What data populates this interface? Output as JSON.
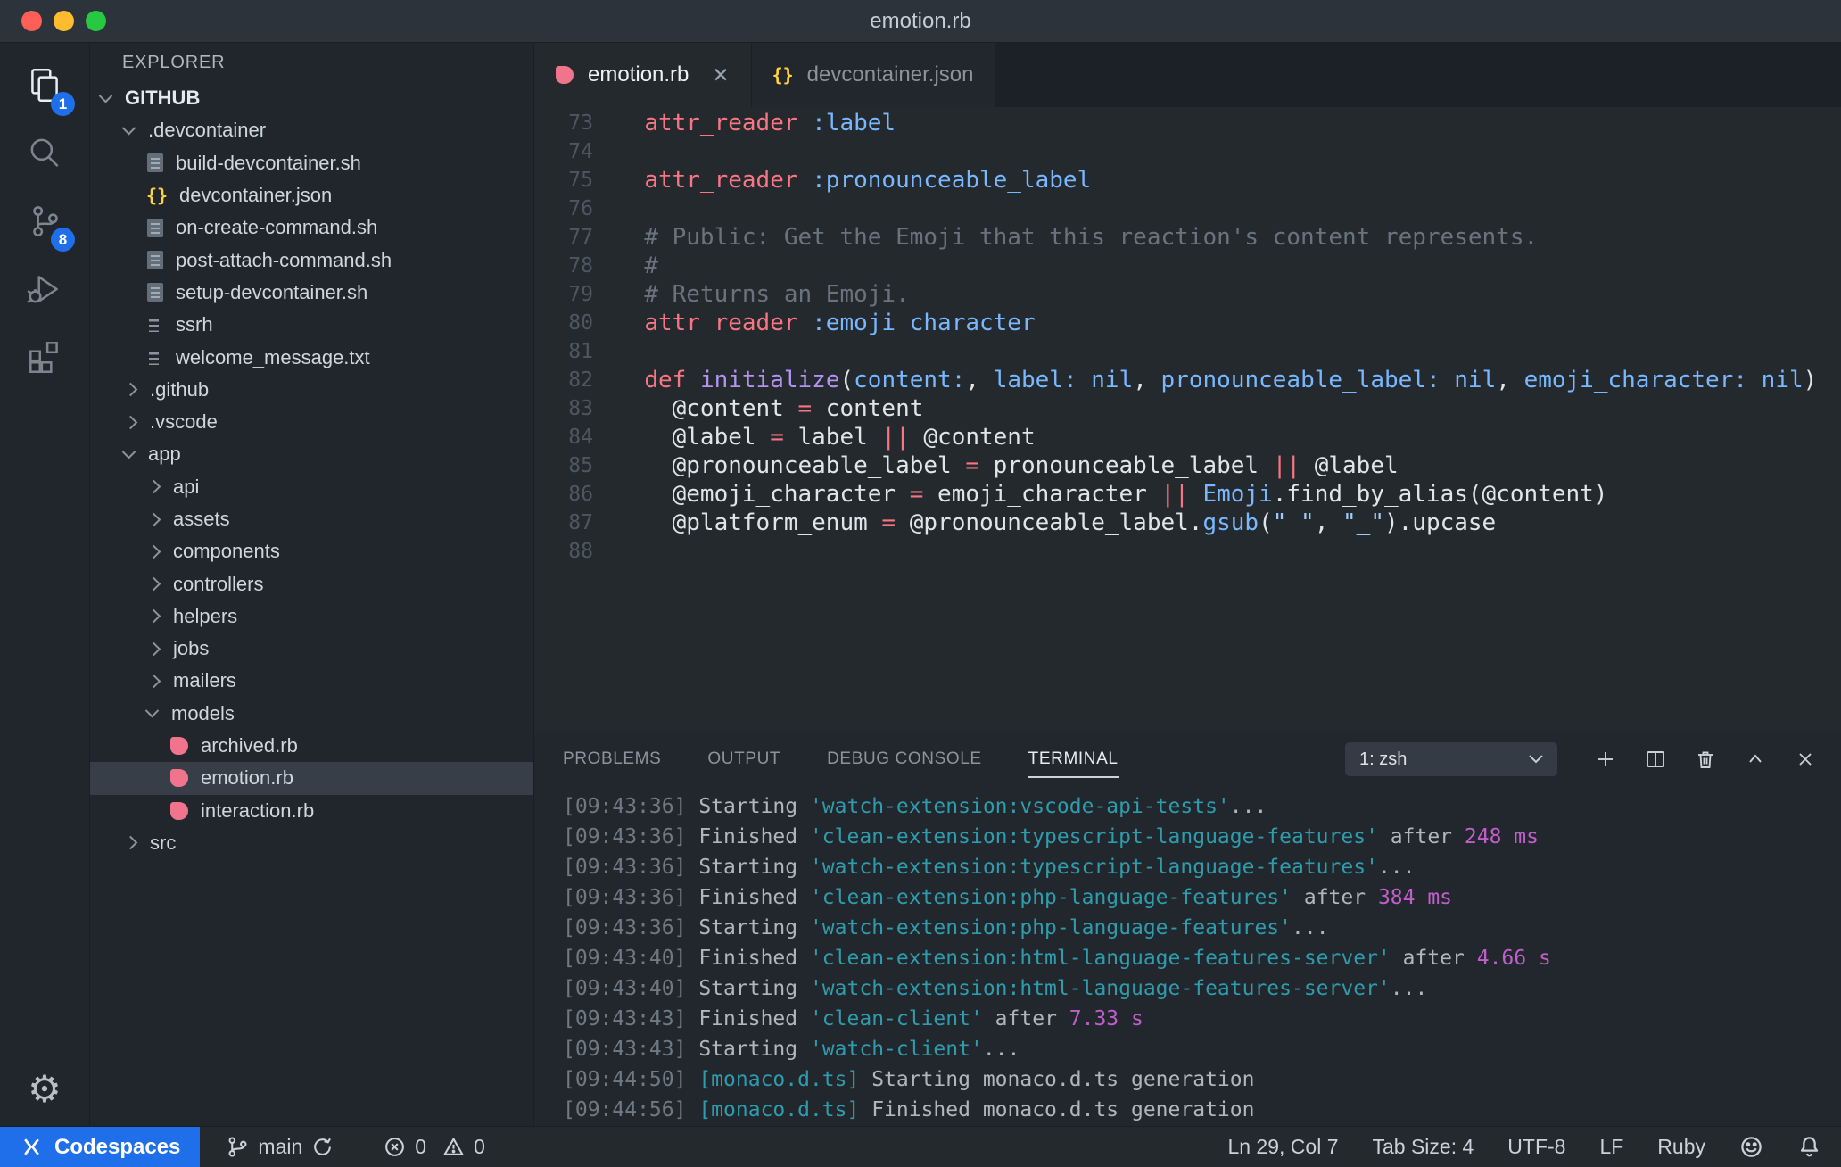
{
  "window": {
    "title": "emotion.rb"
  },
  "colors": {
    "accent_blue": "#1f6feb",
    "ruby_pink": "#f0758c",
    "json_yellow": "#ffd33d",
    "traffic_red": "#ff5f57",
    "traffic_yellow": "#febc2e",
    "traffic_green": "#28c840",
    "syntax_keyword": "#f97583",
    "syntax_symbol": "#79b8ff",
    "syntax_function": "#b392f0",
    "syntax_comment": "#6a737d",
    "syntax_string": "#9ecbff",
    "terminal_task": "#2e9cac",
    "terminal_duration": "#c05fc9"
  },
  "activity_bar": {
    "explorer_badge": "1",
    "source_control_badge": "8"
  },
  "sidebar": {
    "header": "EXPLORER",
    "items": [
      {
        "label": "GITHUB",
        "level": 0,
        "kind": "folder",
        "expanded": true,
        "bold": true
      },
      {
        "label": ".devcontainer",
        "level": 1,
        "kind": "folder",
        "expanded": true
      },
      {
        "label": "build-devcontainer.sh",
        "level": 2,
        "kind": "file",
        "icon": "shell"
      },
      {
        "label": "devcontainer.json",
        "level": 2,
        "kind": "file",
        "icon": "json"
      },
      {
        "label": "on-create-command.sh",
        "level": 2,
        "kind": "file",
        "icon": "shell"
      },
      {
        "label": "post-attach-command.sh",
        "level": 2,
        "kind": "file",
        "icon": "shell"
      },
      {
        "label": "setup-devcontainer.sh",
        "level": 2,
        "kind": "file",
        "icon": "shell"
      },
      {
        "label": "ssrh",
        "level": 2,
        "kind": "file",
        "icon": "text"
      },
      {
        "label": "welcome_message.txt",
        "level": 2,
        "kind": "file",
        "icon": "text"
      },
      {
        "label": ".github",
        "level": 1,
        "kind": "folder",
        "expanded": false
      },
      {
        "label": ".vscode",
        "level": 1,
        "kind": "folder",
        "expanded": false
      },
      {
        "label": "app",
        "level": 1,
        "kind": "folder",
        "expanded": true
      },
      {
        "label": "api",
        "level": 2,
        "kind": "folder",
        "expanded": false
      },
      {
        "label": "assets",
        "level": 2,
        "kind": "folder",
        "expanded": false
      },
      {
        "label": "components",
        "level": 2,
        "kind": "folder",
        "expanded": false
      },
      {
        "label": "controllers",
        "level": 2,
        "kind": "folder",
        "expanded": false
      },
      {
        "label": "helpers",
        "level": 2,
        "kind": "folder",
        "expanded": false
      },
      {
        "label": "jobs",
        "level": 2,
        "kind": "folder",
        "expanded": false
      },
      {
        "label": "mailers",
        "level": 2,
        "kind": "folder",
        "expanded": false
      },
      {
        "label": "models",
        "level": 2,
        "kind": "folder",
        "expanded": true
      },
      {
        "label": "archived.rb",
        "level": 3,
        "kind": "file",
        "icon": "ruby"
      },
      {
        "label": "emotion.rb",
        "level": 3,
        "kind": "file",
        "icon": "ruby",
        "selected": true
      },
      {
        "label": "interaction.rb",
        "level": 3,
        "kind": "file",
        "icon": "ruby"
      },
      {
        "label": "src",
        "level": 1,
        "kind": "folder",
        "expanded": false
      }
    ]
  },
  "editor_tabs": [
    {
      "label": "emotion.rb",
      "icon": "ruby",
      "active": true,
      "close_glyph": "✕"
    },
    {
      "label": "devcontainer.json",
      "icon": "json",
      "active": false
    }
  ],
  "editor": {
    "lines": [
      {
        "num": "73",
        "segments": [
          {
            "c": "pl",
            "t": "  "
          },
          {
            "c": "kw",
            "t": "attr_reader"
          },
          {
            "c": "pl",
            "t": " "
          },
          {
            "c": "sym",
            "t": ":label"
          }
        ]
      },
      {
        "num": "74",
        "segments": []
      },
      {
        "num": "75",
        "segments": [
          {
            "c": "pl",
            "t": "  "
          },
          {
            "c": "kw",
            "t": "attr_reader"
          },
          {
            "c": "pl",
            "t": " "
          },
          {
            "c": "sym",
            "t": ":pronounceable_label"
          }
        ]
      },
      {
        "num": "76",
        "segments": []
      },
      {
        "num": "77",
        "segments": [
          {
            "c": "pl",
            "t": "  "
          },
          {
            "c": "cm",
            "t": "# Public: Get the Emoji that this reaction's content represents."
          }
        ]
      },
      {
        "num": "78",
        "segments": [
          {
            "c": "pl",
            "t": "  "
          },
          {
            "c": "cm",
            "t": "#"
          }
        ]
      },
      {
        "num": "79",
        "segments": [
          {
            "c": "pl",
            "t": "  "
          },
          {
            "c": "cm",
            "t": "# Returns an Emoji."
          }
        ]
      },
      {
        "num": "80",
        "segments": [
          {
            "c": "pl",
            "t": "  "
          },
          {
            "c": "kw",
            "t": "attr_reader"
          },
          {
            "c": "pl",
            "t": " "
          },
          {
            "c": "sym",
            "t": ":emoji_character"
          }
        ]
      },
      {
        "num": "81",
        "segments": []
      },
      {
        "num": "82",
        "segments": [
          {
            "c": "pl",
            "t": "  "
          },
          {
            "c": "kw",
            "t": "def"
          },
          {
            "c": "pl",
            "t": " "
          },
          {
            "c": "fn",
            "t": "initialize"
          },
          {
            "c": "pl",
            "t": "("
          },
          {
            "c": "sym",
            "t": "content:"
          },
          {
            "c": "pl",
            "t": ", "
          },
          {
            "c": "sym",
            "t": "label:"
          },
          {
            "c": "pl",
            "t": " "
          },
          {
            "c": "sym",
            "t": "nil"
          },
          {
            "c": "pl",
            "t": ", "
          },
          {
            "c": "sym",
            "t": "pronounceable_label:"
          },
          {
            "c": "pl",
            "t": " "
          },
          {
            "c": "sym",
            "t": "nil"
          },
          {
            "c": "pl",
            "t": ", "
          },
          {
            "c": "sym",
            "t": "emoji_character:"
          },
          {
            "c": "pl",
            "t": " "
          },
          {
            "c": "sym",
            "t": "nil"
          },
          {
            "c": "pl",
            "t": ")"
          }
        ]
      },
      {
        "num": "83",
        "segments": [
          {
            "c": "pl",
            "t": "    @content "
          },
          {
            "c": "kw",
            "t": "="
          },
          {
            "c": "pl",
            "t": " content"
          }
        ]
      },
      {
        "num": "84",
        "segments": [
          {
            "c": "pl",
            "t": "    @label "
          },
          {
            "c": "kw",
            "t": "="
          },
          {
            "c": "pl",
            "t": " label "
          },
          {
            "c": "kw",
            "t": "||"
          },
          {
            "c": "pl",
            "t": " @content"
          }
        ]
      },
      {
        "num": "85",
        "segments": [
          {
            "c": "pl",
            "t": "    @pronounceable_label "
          },
          {
            "c": "kw",
            "t": "="
          },
          {
            "c": "pl",
            "t": " pronounceable_label "
          },
          {
            "c": "kw",
            "t": "||"
          },
          {
            "c": "pl",
            "t": " @label"
          }
        ]
      },
      {
        "num": "86",
        "segments": [
          {
            "c": "pl",
            "t": "    @emoji_character "
          },
          {
            "c": "kw",
            "t": "="
          },
          {
            "c": "pl",
            "t": " emoji_character "
          },
          {
            "c": "kw",
            "t": "||"
          },
          {
            "c": "pl",
            "t": " "
          },
          {
            "c": "sym",
            "t": "Emoji"
          },
          {
            "c": "pl",
            "t": ".find_by_alias(@content)"
          }
        ]
      },
      {
        "num": "87",
        "segments": [
          {
            "c": "pl",
            "t": "    @platform_enum "
          },
          {
            "c": "kw",
            "t": "="
          },
          {
            "c": "pl",
            "t": " @pronounceable_label."
          },
          {
            "c": "sym",
            "t": "gsub"
          },
          {
            "c": "pl",
            "t": "("
          },
          {
            "c": "str",
            "t": "\" \""
          },
          {
            "c": "pl",
            "t": ", "
          },
          {
            "c": "str",
            "t": "\"_\""
          },
          {
            "c": "pl",
            "t": ").upcase"
          }
        ]
      },
      {
        "num": "88",
        "segments": []
      }
    ]
  },
  "panel": {
    "tabs": [
      {
        "label": "PROBLEMS",
        "active": false
      },
      {
        "label": "OUTPUT",
        "active": false
      },
      {
        "label": "DEBUG CONSOLE",
        "active": false
      },
      {
        "label": "TERMINAL",
        "active": true
      }
    ],
    "dropdown_value": "1: zsh",
    "terminal_lines": [
      [
        {
          "c": "t-time",
          "t": "[09:43:36] "
        },
        {
          "c": "t-txt",
          "t": "Starting "
        },
        {
          "c": "t-task",
          "t": "'watch-extension:vscode-api-tests'"
        },
        {
          "c": "t-txt",
          "t": "..."
        }
      ],
      [
        {
          "c": "t-time",
          "t": "[09:43:36] "
        },
        {
          "c": "t-txt",
          "t": "Finished "
        },
        {
          "c": "t-task",
          "t": "'clean-extension:typescript-language-features'"
        },
        {
          "c": "t-txt",
          "t": " after "
        },
        {
          "c": "t-dur",
          "t": "248 ms"
        }
      ],
      [
        {
          "c": "t-time",
          "t": "[09:43:36] "
        },
        {
          "c": "t-txt",
          "t": "Starting "
        },
        {
          "c": "t-task",
          "t": "'watch-extension:typescript-language-features'"
        },
        {
          "c": "t-txt",
          "t": "..."
        }
      ],
      [
        {
          "c": "t-time",
          "t": "[09:43:36] "
        },
        {
          "c": "t-txt",
          "t": "Finished "
        },
        {
          "c": "t-task",
          "t": "'clean-extension:php-language-features'"
        },
        {
          "c": "t-txt",
          "t": " after "
        },
        {
          "c": "t-dur",
          "t": "384 ms"
        }
      ],
      [
        {
          "c": "t-time",
          "t": "[09:43:36] "
        },
        {
          "c": "t-txt",
          "t": "Starting "
        },
        {
          "c": "t-task",
          "t": "'watch-extension:php-language-features'"
        },
        {
          "c": "t-txt",
          "t": "..."
        }
      ],
      [
        {
          "c": "t-time",
          "t": "[09:43:40] "
        },
        {
          "c": "t-txt",
          "t": "Finished "
        },
        {
          "c": "t-task",
          "t": "'clean-extension:html-language-features-server'"
        },
        {
          "c": "t-txt",
          "t": " after "
        },
        {
          "c": "t-dur",
          "t": "4.66 s"
        }
      ],
      [
        {
          "c": "t-time",
          "t": "[09:43:40] "
        },
        {
          "c": "t-txt",
          "t": "Starting "
        },
        {
          "c": "t-task",
          "t": "'watch-extension:html-language-features-server'"
        },
        {
          "c": "t-txt",
          "t": "..."
        }
      ],
      [
        {
          "c": "t-time",
          "t": "[09:43:43] "
        },
        {
          "c": "t-txt",
          "t": "Finished "
        },
        {
          "c": "t-task",
          "t": "'clean-client'"
        },
        {
          "c": "t-txt",
          "t": " after "
        },
        {
          "c": "t-dur",
          "t": "7.33 s"
        }
      ],
      [
        {
          "c": "t-time",
          "t": "[09:43:43] "
        },
        {
          "c": "t-txt",
          "t": "Starting "
        },
        {
          "c": "t-task",
          "t": "'watch-client'"
        },
        {
          "c": "t-txt",
          "t": "..."
        }
      ],
      [
        {
          "c": "t-time",
          "t": "[09:44:50] "
        },
        {
          "c": "t-task",
          "t": "[monaco.d.ts]"
        },
        {
          "c": "t-txt",
          "t": " Starting monaco.d.ts generation"
        }
      ],
      [
        {
          "c": "t-time",
          "t": "[09:44:56] "
        },
        {
          "c": "t-task",
          "t": "[monaco.d.ts]"
        },
        {
          "c": "t-txt",
          "t": " Finished monaco.d.ts generation"
        }
      ]
    ]
  },
  "status_bar": {
    "remote_label": "Codespaces",
    "branch": "main",
    "errors": "0",
    "warnings": "0",
    "cursor": "Ln 29, Col 7",
    "tab_size": "Tab Size: 4",
    "encoding": "UTF-8",
    "eol": "LF",
    "language": "Ruby"
  }
}
